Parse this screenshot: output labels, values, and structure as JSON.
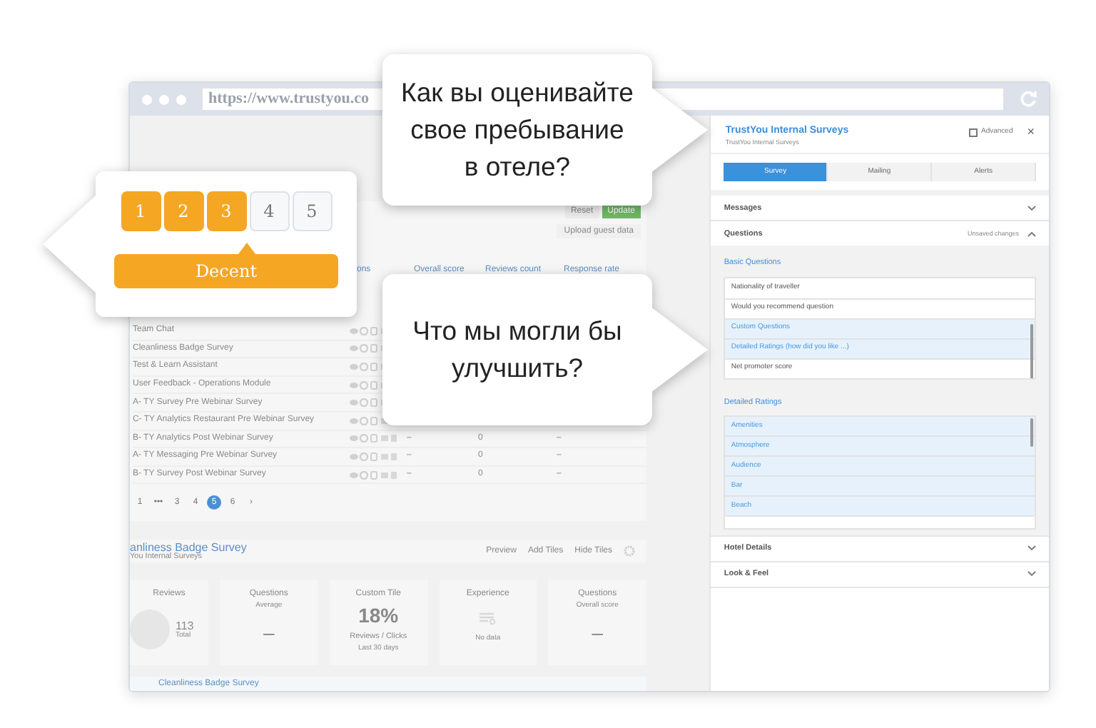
{
  "browser": {
    "url": "https://www.trustyou.co"
  },
  "dashboard": {
    "reset": "Reset",
    "update": "Update",
    "upload": "Upload guest data",
    "columns": [
      "ons",
      "Overall score",
      "Reviews count",
      "Response rate"
    ],
    "rows": [
      {
        "name": "Team Chat"
      },
      {
        "name": "Cleanliness Badge Survey"
      },
      {
        "name": "Test & Learn Assistant"
      },
      {
        "name": "User Feedback - Operations Module"
      },
      {
        "name": "A- TY Survey Pre Webinar Survey"
      },
      {
        "name": "C- TY Analytics Restaurant Pre Webinar Survey"
      },
      {
        "name": "B- TY Analytics Post Webinar Survey",
        "score": "–",
        "count": "0",
        "rate": "–"
      },
      {
        "name": "A- TY Messaging Pre Webinar Survey",
        "score": "–",
        "count": "0",
        "rate": "–"
      },
      {
        "name": "B- TY Survey Post Webinar Survey",
        "score": "–",
        "count": "0",
        "rate": "–"
      }
    ],
    "pages": [
      {
        "label": "1",
        "selected": false
      },
      {
        "label": "•••",
        "selected": false
      },
      {
        "label": "3",
        "selected": false
      },
      {
        "label": "4",
        "selected": false
      },
      {
        "label": "5",
        "selected": true
      },
      {
        "label": "6",
        "selected": false
      },
      {
        "label": "›",
        "selected": false
      }
    ],
    "survey": {
      "title": "anliness Badge Survey",
      "subtitle": "You Internal Surveys",
      "actions": [
        "Preview",
        "Add Tiles",
        "Hide Tiles"
      ]
    },
    "tiles": [
      {
        "kind": "donut",
        "title": "Reviews",
        "value": "113",
        "caption": "Total"
      },
      {
        "kind": "value",
        "title": "Questions",
        "subtitle": "Average",
        "value": "–"
      },
      {
        "kind": "percent",
        "title": "Custom Tile",
        "value": "18%",
        "caption": "Reviews / Clicks",
        "note": "Last 30 days"
      },
      {
        "kind": "empty",
        "title": "Experience",
        "caption": "No data"
      },
      {
        "kind": "value",
        "title": "Questions",
        "subtitle": "Overall score",
        "value": "–"
      }
    ],
    "footer": "Cleanliness Badge Survey"
  },
  "panel": {
    "title": "TrustYou Internal Surveys",
    "subtitle": "TrustYou Internal Surveys",
    "advanced": {
      "label": "Advanced",
      "checked": false
    },
    "close": "×",
    "tabs": [
      {
        "label": "Survey",
        "selected": true
      },
      {
        "label": "Mailing",
        "selected": false
      },
      {
        "label": "Alerts",
        "selected": false
      }
    ],
    "sections": [
      {
        "title": "Messages",
        "expanded": false
      },
      {
        "title": "Questions",
        "expanded": true,
        "note": "Unsaved changes",
        "groups": [
          {
            "title": "Basic Questions",
            "items": [
              {
                "label": "Nationality of traveller",
                "selected": false
              },
              {
                "label": "Would you recommend question",
                "selected": false
              },
              {
                "label": "Custom Questions",
                "selected": true
              },
              {
                "label": "Detailed Ratings (how did you like ...)",
                "selected": true
              },
              {
                "label": "Net promoter score",
                "selected": false
              }
            ]
          },
          {
            "title": "Detailed Ratings",
            "items": [
              {
                "label": "Amenities",
                "selected": true
              },
              {
                "label": "Atmosphere",
                "selected": true
              },
              {
                "label": "Audience",
                "selected": true
              },
              {
                "label": "Bar",
                "selected": true
              },
              {
                "label": "Beach",
                "selected": true
              }
            ]
          }
        ]
      },
      {
        "title": "Hotel Details",
        "expanded": false
      },
      {
        "title": "Look & Feel",
        "expanded": false
      }
    ]
  },
  "callouts": {
    "rating": {
      "options": [
        {
          "label": "1",
          "filled": true
        },
        {
          "label": "2",
          "filled": true
        },
        {
          "label": "3",
          "filled": true
        },
        {
          "label": "4",
          "filled": false
        },
        {
          "label": "5",
          "filled": false
        }
      ],
      "caption": "Decent"
    },
    "bubbles": [
      "Как вы оценивайте\nсвое пребывание\nв отеле?",
      "Что мы могли бы\nулучшить?"
    ]
  }
}
